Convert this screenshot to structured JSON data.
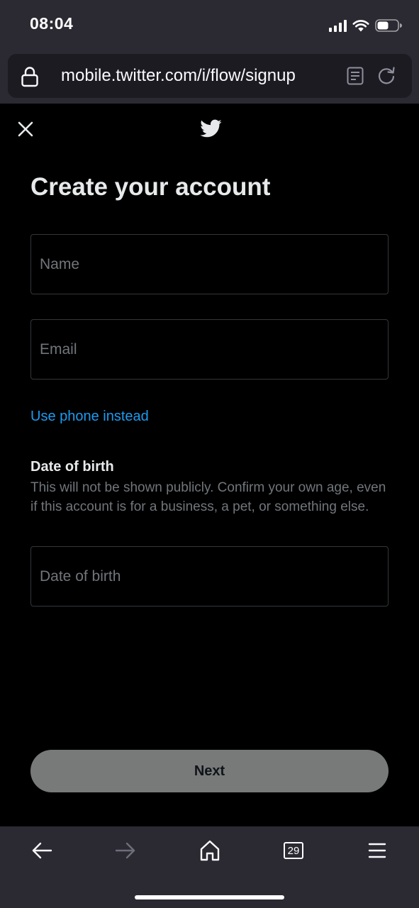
{
  "status_bar": {
    "time": "08:04",
    "icons": [
      "signal-icon",
      "wifi-icon",
      "battery-icon"
    ]
  },
  "browser": {
    "url": "mobile.twitter.com/i/flow/signup",
    "icons": [
      "lock-icon",
      "reader-view-icon",
      "reload-icon"
    ],
    "toolbar": {
      "icons": [
        "back-arrow-icon",
        "forward-arrow-icon",
        "home-icon",
        "tabs-icon",
        "menu-icon"
      ],
      "tab_count": "29"
    }
  },
  "header": {
    "icons": [
      "close-icon",
      "twitter-bird-icon"
    ]
  },
  "form": {
    "title": "Create your account",
    "name_placeholder": "Name",
    "email_placeholder": "Email",
    "use_phone_label": "Use phone instead",
    "dob_heading": "Date of birth",
    "dob_description": "This will not be shown publicly. Confirm your own age, even if this account is for a business, a pet, or something else.",
    "dob_placeholder": "Date of birth",
    "next_label": "Next"
  },
  "colors": {
    "accent": "#1d9bf0",
    "background": "#000000",
    "browser_chrome": "#2b2a33",
    "button_disabled": "#787a7a"
  }
}
